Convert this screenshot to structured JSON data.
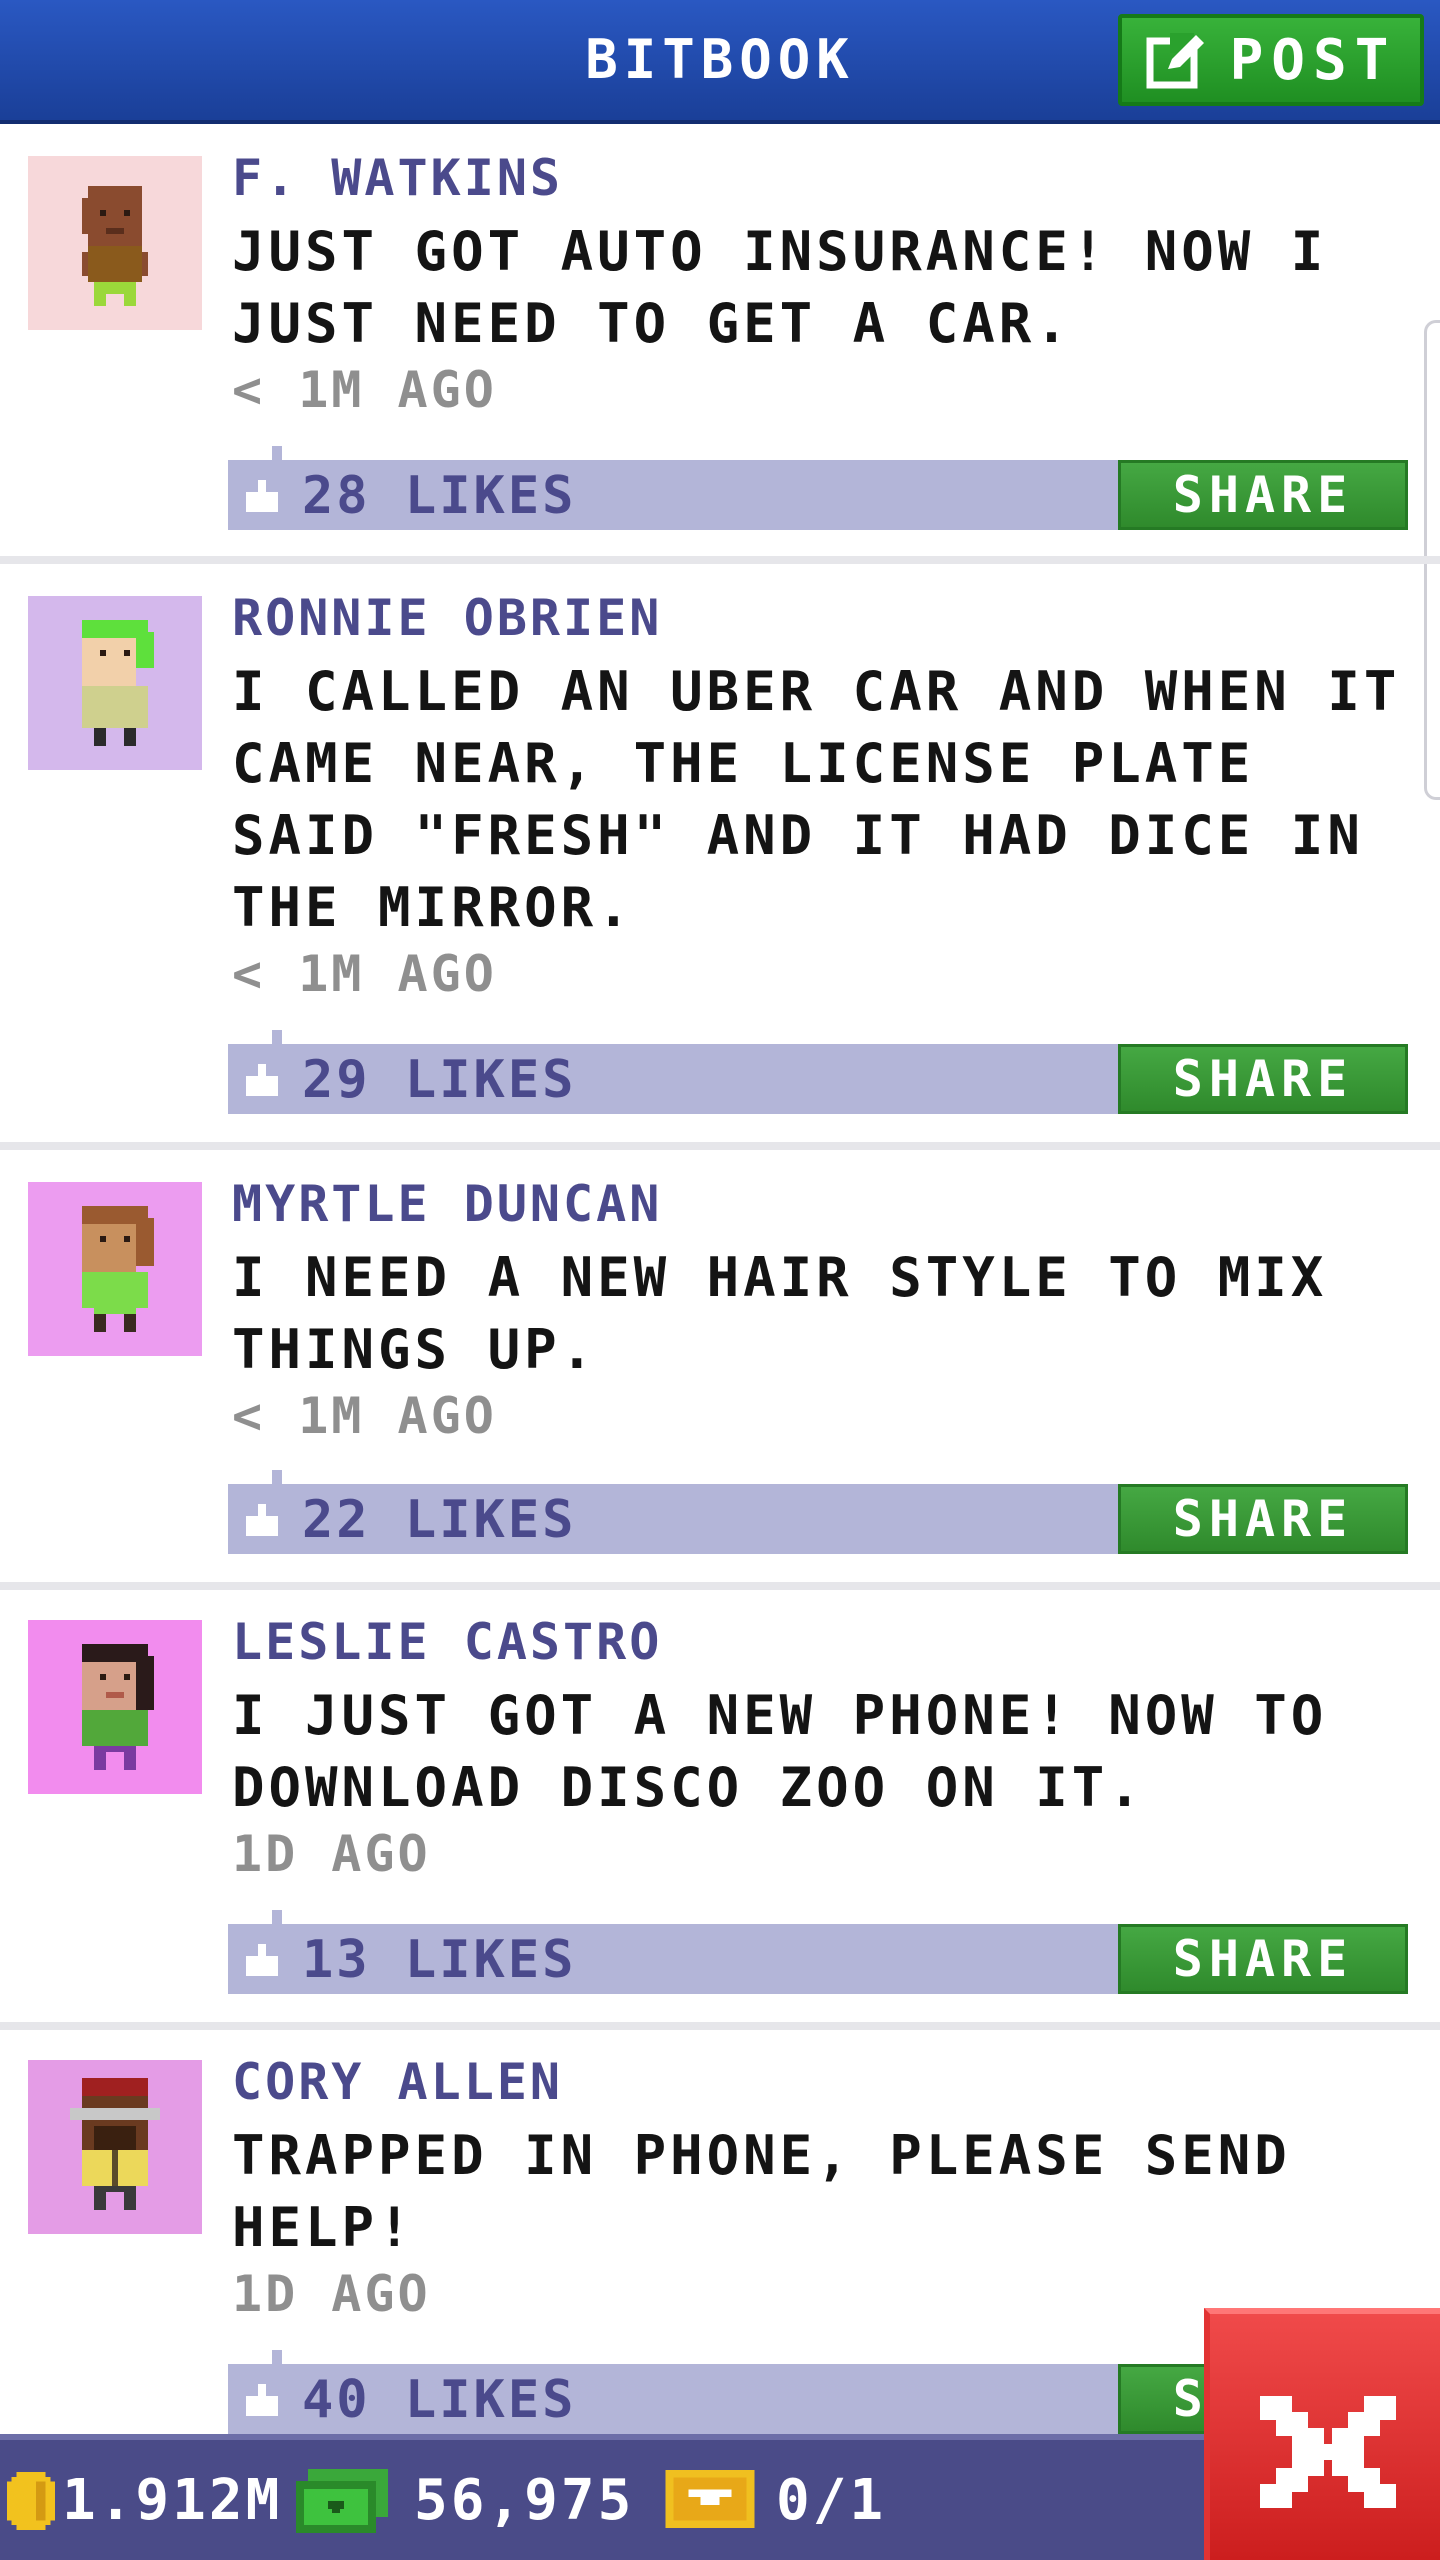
{
  "header": {
    "title": "BITBOOK",
    "post_label": "POST"
  },
  "posts": [
    {
      "name": "F. WATKINS",
      "message": "JUST GOT AUTO INSURANCE! NOW I JUST NEED TO GET A CAR.",
      "time": "< 1M AGO",
      "likes": "28 LIKES",
      "share_label": "SHARE",
      "avatar_bg": "#f7d8da"
    },
    {
      "name": "RONNIE OBRIEN",
      "message": "I CALLED AN UBER CAR AND WHEN IT CAME NEAR, THE LICENSE PLATE SAID \"FRESH\" AND IT HAD DICE IN THE MIRROR.",
      "time": "< 1M AGO",
      "likes": "29 LIKES",
      "share_label": "SHARE",
      "avatar_bg": "#d4b8ec"
    },
    {
      "name": "MYRTLE DUNCAN",
      "message": "I NEED A NEW HAIR STYLE TO MIX THINGS UP.",
      "time": "< 1M AGO",
      "likes": "22 LIKES",
      "share_label": "SHARE",
      "avatar_bg": "#ec9cf0"
    },
    {
      "name": "LESLIE CASTRO",
      "message": "I JUST GOT A NEW PHONE! NOW TO DOWNLOAD DISCO ZOO ON IT.",
      "time": "1D AGO",
      "likes": "13 LIKES",
      "share_label": "SHARE",
      "avatar_bg": "#f28cee"
    },
    {
      "name": "CORY ALLEN",
      "message": "TRAPPED IN PHONE, PLEASE SEND HELP!",
      "time": "1D AGO",
      "likes": "40 LIKES",
      "share_label": "SHARE",
      "avatar_bg": "#e49ce6"
    }
  ],
  "footer": {
    "coins": "1.912M",
    "cash": "56,975",
    "tickets": "0/1"
  },
  "colors": {
    "header": "#2a58c2",
    "accent_green": "#2f9a30",
    "like_bar": "#b3b5d8",
    "name_text": "#4b4a8c",
    "close_red": "#e03030"
  }
}
